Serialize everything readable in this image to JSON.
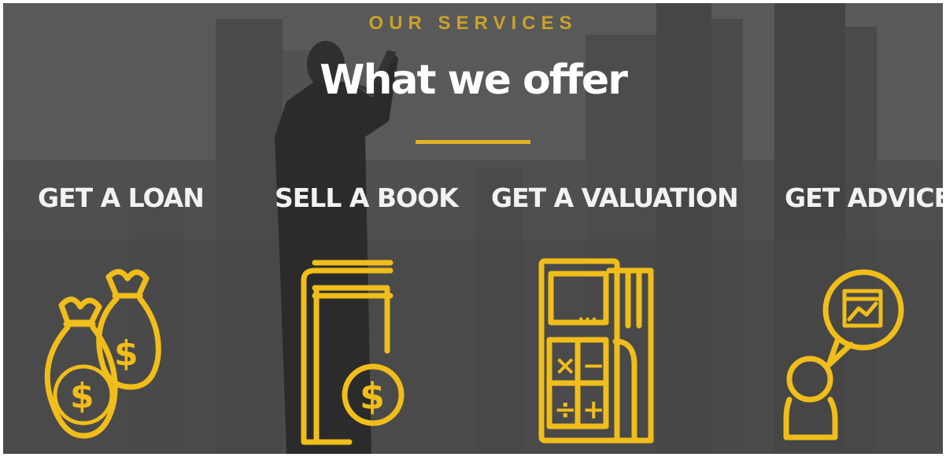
{
  "header": {
    "eyebrow": "OUR SERVICES",
    "title": "What we offer"
  },
  "services": [
    {
      "label": "GET A LOAN",
      "icon": "money-bags-icon"
    },
    {
      "label": "SELL A BOOK",
      "icon": "book-with-coin-icon"
    },
    {
      "label": "GET A VALUATION",
      "icon": "calculator-icon"
    },
    {
      "label": "GET ADVICE",
      "icon": "advice-person-chart-icon"
    }
  ],
  "icon_glyphs": {
    "dollar": "$",
    "times": "×",
    "minus": "−",
    "divide": "÷",
    "plus": "+",
    "dots": "..."
  },
  "colors": {
    "accent": "#f0bd1a",
    "eyebrow": "#c9a22a",
    "title": "#ffffff",
    "background": "#4e4e4e"
  }
}
